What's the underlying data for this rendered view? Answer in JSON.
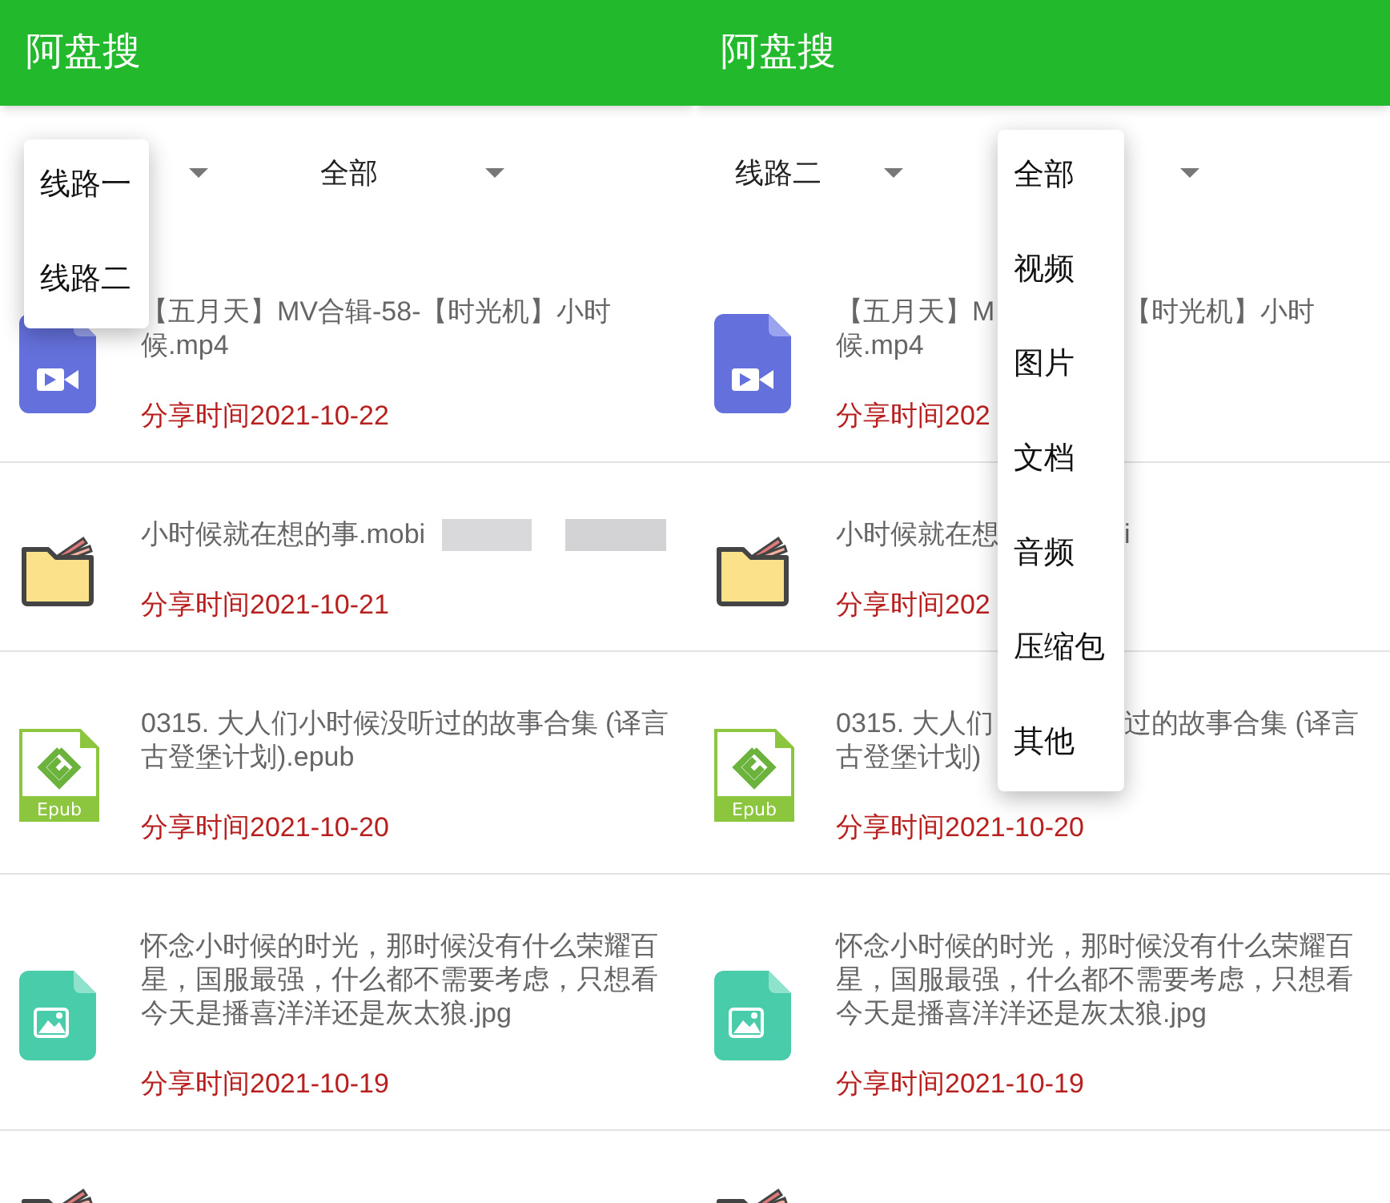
{
  "panels": [
    {
      "title": "阿盘搜",
      "filters": [
        {
          "open": true
        },
        {
          "value": "全部",
          "open": false
        }
      ],
      "menu": {
        "items": [
          "线路一",
          "线路二"
        ]
      },
      "rows": [
        {
          "kind": "video",
          "lines": [
            [
              "【五月天】MV合辑-58-【时光机】小时"
            ],
            [
              "候.mp4"
            ]
          ],
          "date": "分享时间2021-10-22",
          "redacted": false
        },
        {
          "kind": "folder",
          "lines": [
            [
              "小时候就在想的事.mobi"
            ]
          ],
          "date": "分享时间2021-10-21",
          "redacted": true
        },
        {
          "kind": "epub",
          "icon_label": "Epub",
          "lines": [
            [
              "0315. 大人们小时候没听过的故事合集 (译言"
            ],
            [
              "古登堡计划).epub"
            ]
          ],
          "date": "分享时间2021-10-20",
          "redacted": false
        },
        {
          "kind": "image",
          "lines": [
            [
              "怀念小时候的时光，那时候没有什么荣耀百"
            ],
            [
              "星，国服最强，什么都不需要考虑，只想看"
            ],
            [
              "今天是播喜洋洋还是灰太狼.jpg"
            ]
          ],
          "date": "分享时间2021-10-19",
          "redacted": false
        },
        {
          "kind": "folder",
          "redacted": false
        }
      ]
    },
    {
      "title": "阿盘搜",
      "filters": [
        {
          "value": "线路二",
          "open": false
        },
        {
          "open": true
        }
      ],
      "menu": {
        "items": [
          "全部",
          "视频",
          "图片",
          "文档",
          "音频",
          "压缩包",
          "其他"
        ]
      },
      "rows": [
        {
          "kind": "video",
          "lines": [
            [
              "【五月天】M",
              "【时光机】小时"
            ],
            [
              "候.mp4"
            ]
          ],
          "date": "分享时间202",
          "redacted": false
        },
        {
          "kind": "folder",
          "lines": [
            [
              "小时候就在想",
              "i"
            ]
          ],
          "date": "分享时间202",
          "redacted": false
        },
        {
          "kind": "epub",
          "icon_label": "Epub",
          "lines": [
            [
              "0315. 大人们",
              "过的故事合集 (译言"
            ],
            [
              "古登堡计划)"
            ]
          ],
          "date": "分享时间2021-10-20",
          "redacted": false
        },
        {
          "kind": "image",
          "lines": [
            [
              "怀念小时候的时光，那时候没有什么荣耀百"
            ],
            [
              "星，国服最强，什么都不需要考虑，只想看"
            ],
            [
              "今天是播喜洋洋还是灰太狼.jpg"
            ]
          ],
          "date": "分享时间2021-10-19",
          "redacted": false
        },
        {
          "kind": "folder",
          "redacted": false
        }
      ]
    }
  ]
}
